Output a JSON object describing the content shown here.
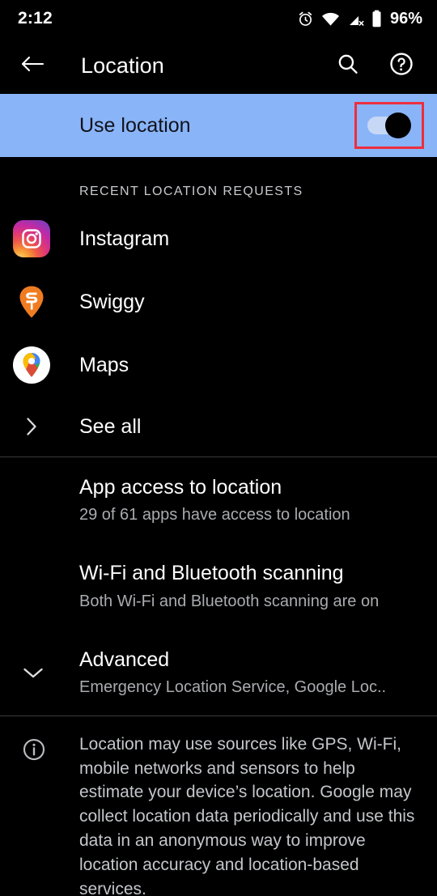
{
  "status_bar": {
    "time": "2:12",
    "battery_percent": "96%",
    "icons": [
      "alarm-icon",
      "wifi-icon",
      "mobile-data-off-icon",
      "battery-icon"
    ]
  },
  "app_bar": {
    "title": "Location",
    "back_icon": "arrow-back-icon",
    "search_icon": "search-icon",
    "help_icon": "help-circle-icon"
  },
  "use_location": {
    "label": "Use location",
    "toggle_state": "on",
    "highlight_color": "#8ab4f8",
    "annotation_color": "#ed2e3e"
  },
  "recent_requests": {
    "header": "RECENT LOCATION REQUESTS",
    "apps": [
      {
        "name": "Instagram",
        "icon": "instagram-icon"
      },
      {
        "name": "Swiggy",
        "icon": "swiggy-icon"
      },
      {
        "name": "Maps",
        "icon": "google-maps-icon"
      }
    ],
    "see_all": "See all",
    "see_all_icon": "chevron-right-icon"
  },
  "settings": [
    {
      "title": "App access to location",
      "subtitle": "29 of 61 apps have access to location"
    },
    {
      "title": "Wi-Fi and Bluetooth scanning",
      "subtitle": "Both Wi-Fi and Bluetooth scanning are on"
    },
    {
      "title": "Advanced",
      "subtitle": "Emergency Location Service, Google Loc..",
      "icon": "chevron-down-icon"
    }
  ],
  "footer": {
    "icon": "info-icon",
    "text": "Location may use sources like GPS, Wi-Fi, mobile networks and sensors to help estimate your device’s location. Google may collect location data periodically and use this data in an anonymous way to improve location accuracy and location-based services."
  }
}
